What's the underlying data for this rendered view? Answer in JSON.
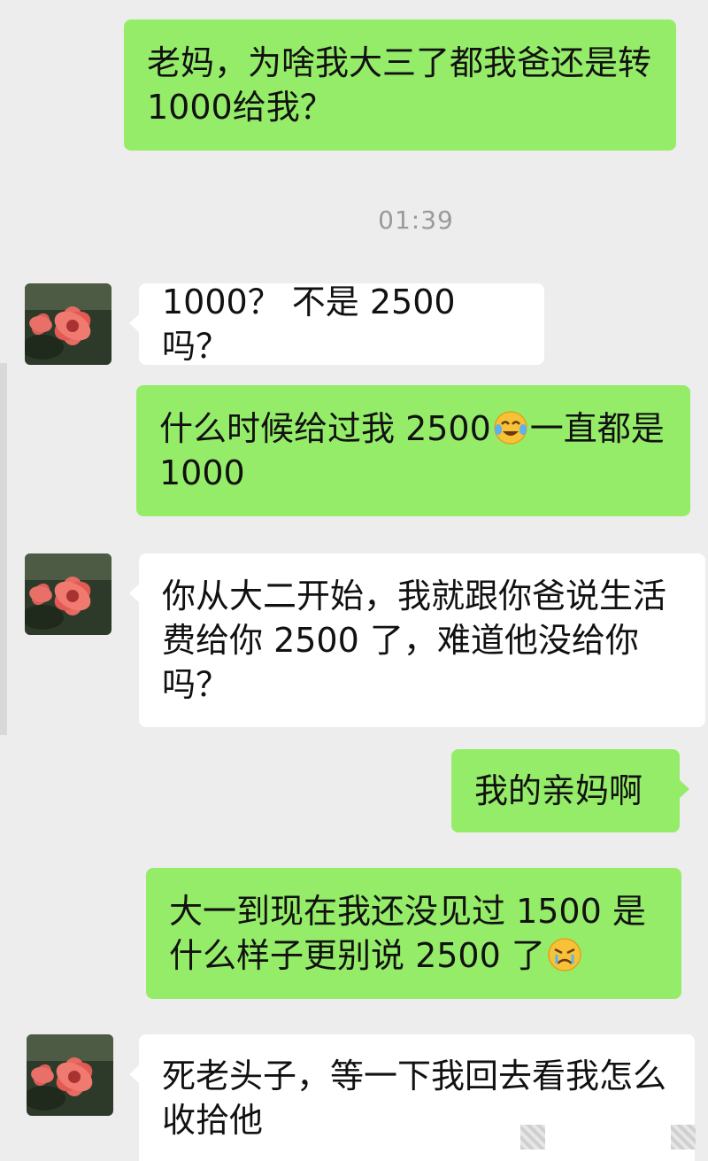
{
  "timestamp": "01:39",
  "contact": {
    "avatar_icon": "flower-avatar-icon"
  },
  "messages": [
    {
      "id": "m1",
      "side": "out",
      "text": "老妈，为啥我大三了都我爸还是转1000给我？"
    },
    {
      "id": "m2",
      "side": "in",
      "text": "1000？ 不是 2500 吗？"
    },
    {
      "id": "m3",
      "side": "out",
      "text_before": "什么时候给过我 2500",
      "emoji": "crying-laughing-emoji-icon",
      "text_after": "一直都是1000"
    },
    {
      "id": "m4",
      "side": "in",
      "text": "你从大二开始，我就跟你爸说生活费给你 2500 了，难道他没给你吗？"
    },
    {
      "id": "m5",
      "side": "out",
      "text": "我的亲妈啊"
    },
    {
      "id": "m6",
      "side": "out",
      "text_before": "大一到现在我还没见过 1500 是什么样子更别说 2500 了",
      "emoji": "tears-emoji-icon",
      "text_after": ""
    },
    {
      "id": "m7",
      "side": "in",
      "text": "死老头子，等一下我回去看我怎么收拾他"
    }
  ],
  "colors": {
    "background": "#ededed",
    "outgoing_bubble": "#95ec69",
    "incoming_bubble": "#ffffff",
    "timestamp_text": "#9a9a9a"
  }
}
